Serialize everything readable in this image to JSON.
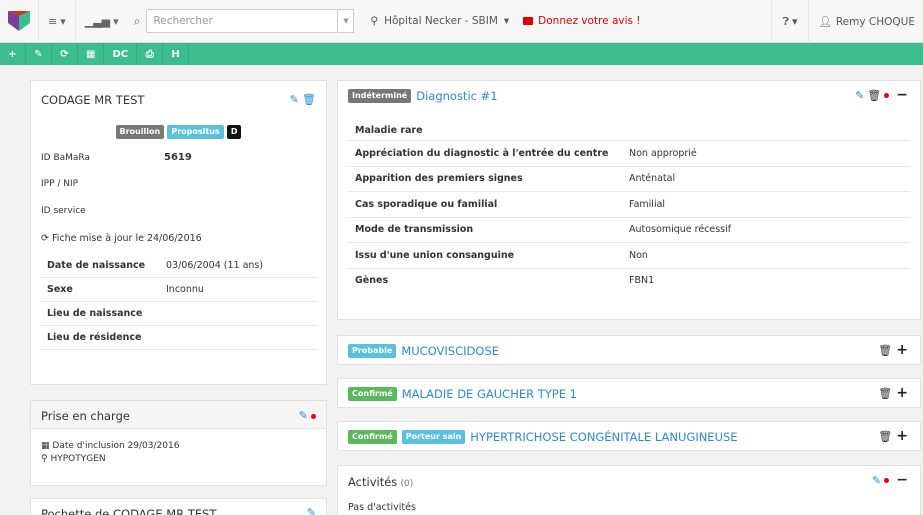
{
  "topbar": {
    "menu_caret": "▾",
    "chart_caret": "▾",
    "search_placeholder": "Rechercher",
    "hospital": "Hôpital Necker - SBIM",
    "hospital_caret": "▾",
    "feedback": "Donnez votre avis !",
    "help_caret": "▾",
    "user": "Remy CHOQUE"
  },
  "toolbar": {
    "buttons": [
      "+",
      "✎",
      "⟳",
      "▦",
      "DC",
      "⎙",
      "H"
    ]
  },
  "patient": {
    "title": "CODAGE MR TEST",
    "badges": [
      "Brouillon",
      "Propositus",
      "D"
    ],
    "id_bamara_label": "ID BaMaRa",
    "id_bamara_value": "5619",
    "ipp_label": "IPP / NIP",
    "id_service_label": "ID service",
    "updated": "Fiche mise à jour le 24/06/2016",
    "rows": [
      {
        "label": "Date de naissance",
        "value": "03/06/2004 (11 ans)"
      },
      {
        "label": "Sexe",
        "value": "Inconnu"
      },
      {
        "label": "Lieu de naissance",
        "value": ""
      },
      {
        "label": "Lieu de résidence",
        "value": ""
      }
    ]
  },
  "prise": {
    "title": "Prise en charge",
    "inclusion": "Date d'inclusion 29/03/2016",
    "location": "HYPOTYGEN"
  },
  "pochette": {
    "title": "Pochette de CODAGE MR TEST"
  },
  "diagnostic": {
    "badge": "Indéterminé",
    "title": "Diagnostic #1",
    "heading": "Maladie rare",
    "rows": [
      {
        "label": "Appréciation du diagnostic à l'entrée du centre",
        "value": "Non approprié"
      },
      {
        "label": "Apparition des premiers signes",
        "value": "Anténatal"
      },
      {
        "label": "Cas sporadique ou familial",
        "value": "Familial"
      },
      {
        "label": "Mode de transmission",
        "value": "Autosomique récessif"
      },
      {
        "label": "Issu d'une union consanguine",
        "value": "Non"
      },
      {
        "label": "Gènes",
        "value": "FBN1"
      }
    ]
  },
  "diseases": [
    {
      "badges": [
        "Probable"
      ],
      "name": "MUCOVISCIDOSE"
    },
    {
      "badges": [
        "Confirmé"
      ],
      "name": "MALADIE DE GAUCHER TYPE 1"
    },
    {
      "badges": [
        "Confirmé",
        "Porteur sain"
      ],
      "name": "HYPERTRICHOSE CONGÉNITALE LANUGINEUSE"
    }
  ],
  "activites": {
    "title": "Activités",
    "count": "(0)",
    "empty": "Pas d'activités"
  },
  "colors": {
    "accent": "#3dbd8f",
    "link": "#2a8bd6",
    "danger": "#dd0000"
  }
}
